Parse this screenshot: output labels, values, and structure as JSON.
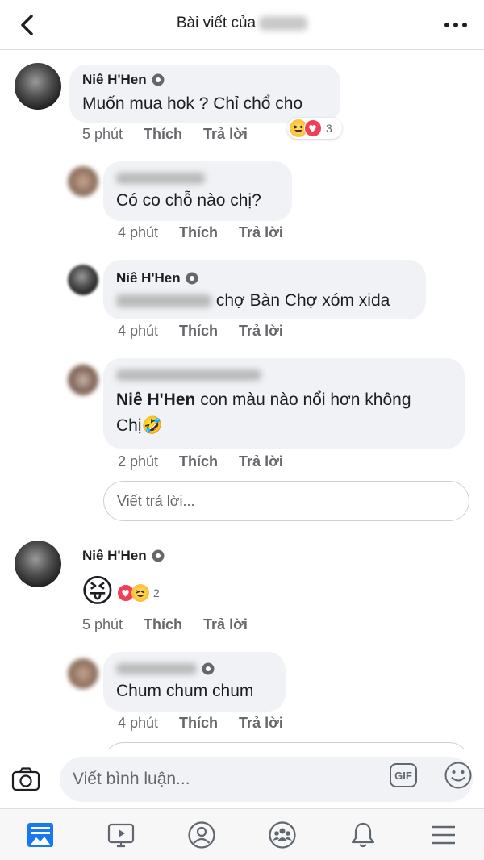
{
  "header": {
    "title": "Bài viết của"
  },
  "comments": [
    {
      "author": "Niê H'Hen",
      "text": "Muốn mua hok ? Chỉ chổ cho",
      "time": "5 phút",
      "like": "Thích",
      "reply": "Trả lời",
      "reaction_count": "3",
      "replies": [
        {
          "text": "Có co chỗ nào chị?",
          "time": "4 phút",
          "like": "Thích",
          "reply": "Trả lời"
        },
        {
          "author": "Niê H'Hen",
          "text": "chợ Bàn Chợ xóm xida",
          "time": "4 phút",
          "like": "Thích",
          "reply": "Trả lời"
        },
        {
          "mention": "Niê H'Hen",
          "text": "con màu nào nổi hơn không",
          "text2": "Chị🤣",
          "time": "2 phút",
          "like": "Thích",
          "reply": "Trả lời"
        }
      ],
      "reply_placeholder": "Viết trả lời..."
    },
    {
      "author": "Niê H'Hen",
      "emoji": "😝",
      "time": "5 phút",
      "like": "Thích",
      "reply": "Trả lời",
      "reaction_count": "2",
      "replies": [
        {
          "text": "Chum chum chum",
          "time": "4 phút",
          "like": "Thích",
          "reply": "Trả lời"
        }
      ]
    }
  ],
  "composer": {
    "placeholder": "Viết bình luận...",
    "gif_label": "GIF"
  },
  "tabs": [
    "news-feed",
    "watch",
    "profile",
    "groups",
    "notifications",
    "menu"
  ],
  "colors": {
    "brand": "#1877f2",
    "bubble": "#f0f2f5",
    "meta": "#65676b"
  }
}
